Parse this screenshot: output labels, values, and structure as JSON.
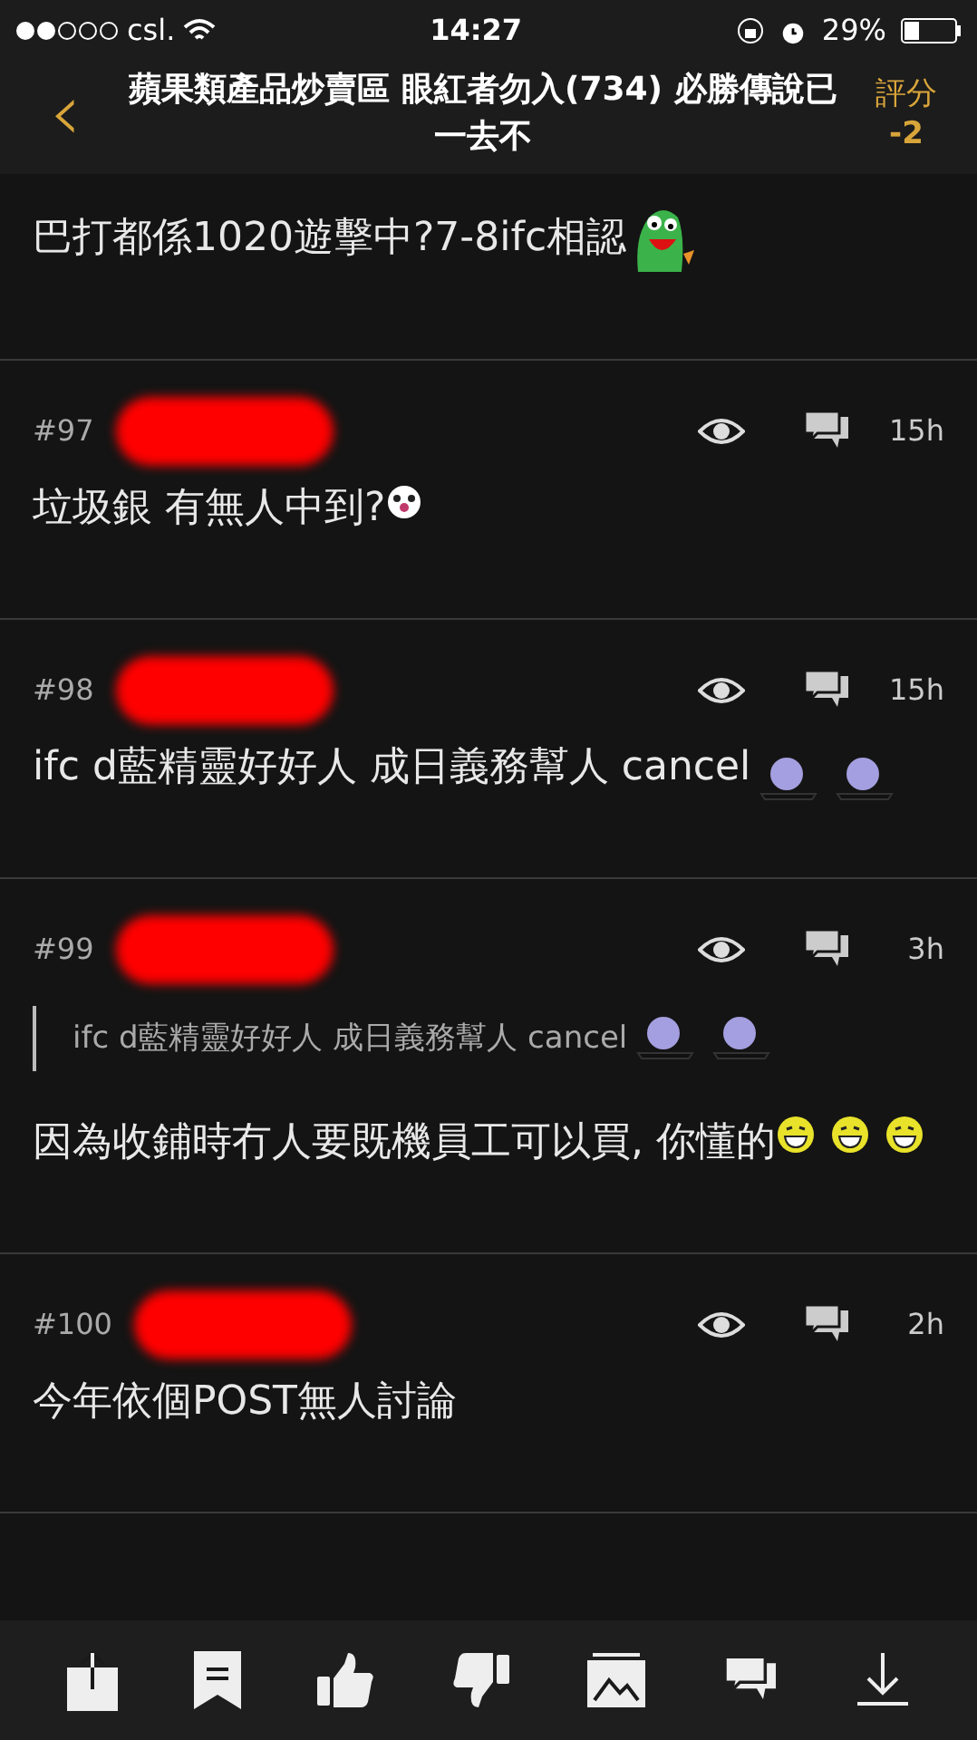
{
  "status_bar": {
    "carrier": "csl.",
    "time": "14:27",
    "battery": "29%"
  },
  "header": {
    "back": "‹",
    "title": "蘋果類產品炒賣區 眼紅者勿入(734) 必勝傳說已一去不",
    "score_label": "評分",
    "score": "-2"
  },
  "posts": [
    {
      "body": [
        {
          "kind": "text",
          "text": "巴打都係1020遊擊中?7-8ifc相認"
        },
        {
          "kind": "frog"
        }
      ]
    },
    {
      "number": "#97",
      "time": "15h",
      "body": [
        {
          "kind": "text",
          "text": "垃圾銀 有無人中到?"
        },
        {
          "kind": "clown"
        }
      ]
    },
    {
      "number": "#98",
      "time": "15h",
      "body": [
        {
          "kind": "text",
          "text": "ifc d藍精靈好好人 成日義務幫人 cancel"
        },
        {
          "kind": "smurf"
        },
        {
          "kind": "smurf"
        }
      ]
    },
    {
      "number": "#99",
      "time": "3h",
      "quote": [
        {
          "kind": "text",
          "text": "ifc d藍精靈好好人 成日義務幫人 cancel"
        },
        {
          "kind": "smurf"
        },
        {
          "kind": "smurf"
        }
      ],
      "body": [
        {
          "kind": "text",
          "text": "因為收鋪時冇人要既機員工可以買, 你懂的"
        },
        {
          "kind": "grin"
        },
        {
          "kind": "grin"
        },
        {
          "kind": "grin"
        }
      ]
    },
    {
      "number": "#100",
      "time": "2h",
      "body": [
        {
          "kind": "text",
          "text": "今年依個POST無人討論"
        }
      ]
    }
  ],
  "toolbar": [
    {
      "kind": "share"
    },
    {
      "kind": "bookmark"
    },
    {
      "kind": "like"
    },
    {
      "kind": "dislike"
    },
    {
      "kind": "image"
    },
    {
      "kind": "reply"
    },
    {
      "kind": "download"
    }
  ]
}
